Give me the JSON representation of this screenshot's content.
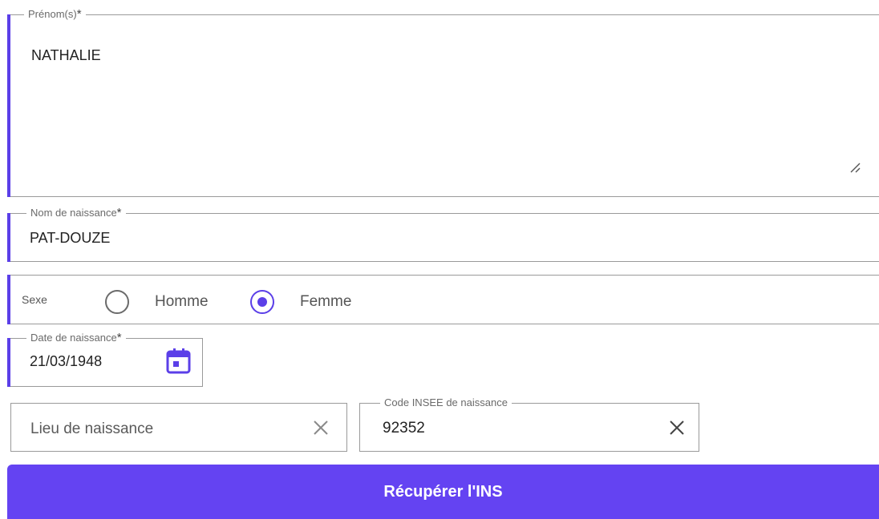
{
  "form": {
    "prenoms": {
      "label": "Prénom(s)",
      "required_mark": "*",
      "value": "NATHALIE"
    },
    "nom_naissance": {
      "label": "Nom de naissance",
      "required_mark": "*",
      "value": "PAT-DOUZE"
    },
    "sexe": {
      "label": "Sexe",
      "options": [
        {
          "label": "Homme",
          "selected": false
        },
        {
          "label": "Femme",
          "selected": true
        }
      ]
    },
    "date_naissance": {
      "label": "Date de naissance",
      "required_mark": "*",
      "value": "21/03/1948",
      "icon": "calendar-icon"
    },
    "lieu_naissance": {
      "placeholder": "Lieu de naissance",
      "clear_icon": "close-icon"
    },
    "code_insee": {
      "label": "Code INSEE de naissance",
      "value": "92352",
      "clear_icon": "close-icon"
    },
    "submit_label": "Récupérer l'INS"
  },
  "colors": {
    "accent": "#5b3fe8",
    "button": "#6443f2",
    "border": "#9a9a9a"
  }
}
